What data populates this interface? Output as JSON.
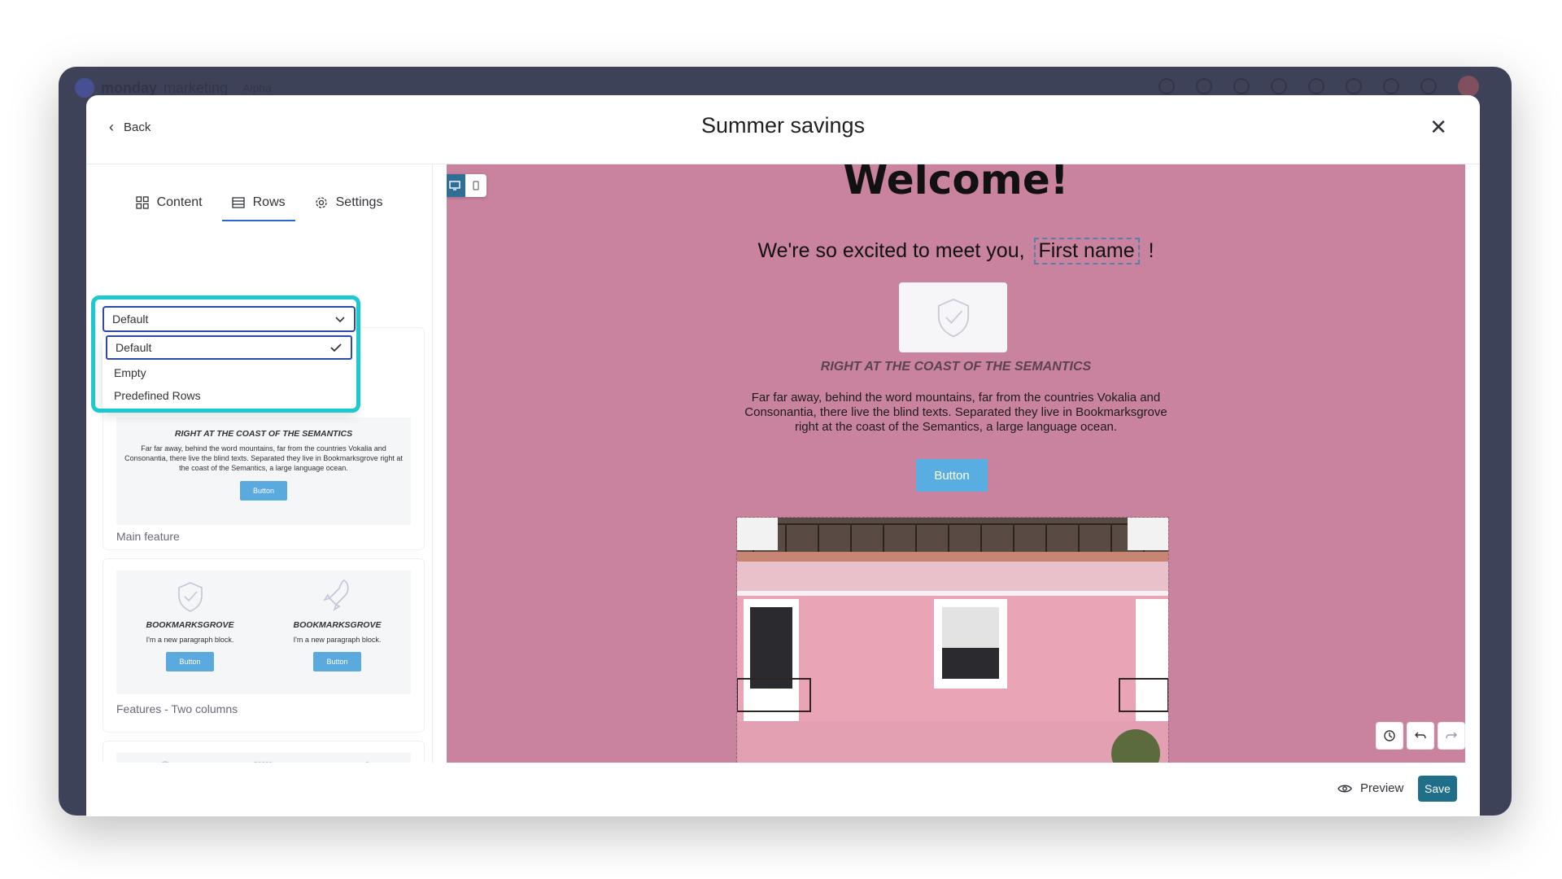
{
  "app": {
    "brand": "monday",
    "brand_sub": "marketing",
    "tag": "Alpha"
  },
  "modal": {
    "back_label": "Back",
    "title": "Summer savings",
    "close_icon": "close-icon"
  },
  "tabs": [
    {
      "label": "Content",
      "icon": "grid-icon"
    },
    {
      "label": "Rows",
      "icon": "rows-icon",
      "active": true
    },
    {
      "label": "Settings",
      "icon": "gear-icon"
    }
  ],
  "row_selector": {
    "selected": "Default",
    "options": [
      "Default",
      "Empty",
      "Predefined Rows"
    ]
  },
  "rows": {
    "main_feature": {
      "heading": "RIGHT AT THE COAST OF THE SEMANTICS",
      "text": "Far far away, behind the word mountains, far from the countries Vokalia and Consonantia, there live the blind texts. Separated they live in Bookmarksgrove right at the coast of the Semantics, a large language ocean.",
      "button": "Button",
      "caption": "Main feature"
    },
    "two_columns": {
      "col1_heading": "BOOKMARKSGROVE",
      "col1_text": "I'm a new paragraph block.",
      "col1_button": "Button",
      "col2_heading": "BOOKMARKSGROVE",
      "col2_text": "I'm a new paragraph block.",
      "col2_button": "Button",
      "caption": "Features - Two columns"
    }
  },
  "canvas": {
    "background": "#c9839f",
    "welcome": "Welcome!",
    "greeting_prefix": "We're so excited to meet you,",
    "merge_tag": "First name",
    "greeting_suffix": "!",
    "heading": "RIGHT AT THE COAST OF THE SEMANTICS",
    "paragraph": "Far far away, behind the word mountains, far from the countries Vokalia and Consonantia, there live the blind texts. Separated they live in Bookmarksgrove right at the coast of the Semantics, a large language ocean.",
    "button": "Button"
  },
  "footer": {
    "preview_label": "Preview",
    "save_label": "Save"
  },
  "colors": {
    "highlight": "#1ec8cf",
    "accent": "#2c4ba6",
    "save": "#1f6f8b",
    "button": "#58aee0"
  }
}
